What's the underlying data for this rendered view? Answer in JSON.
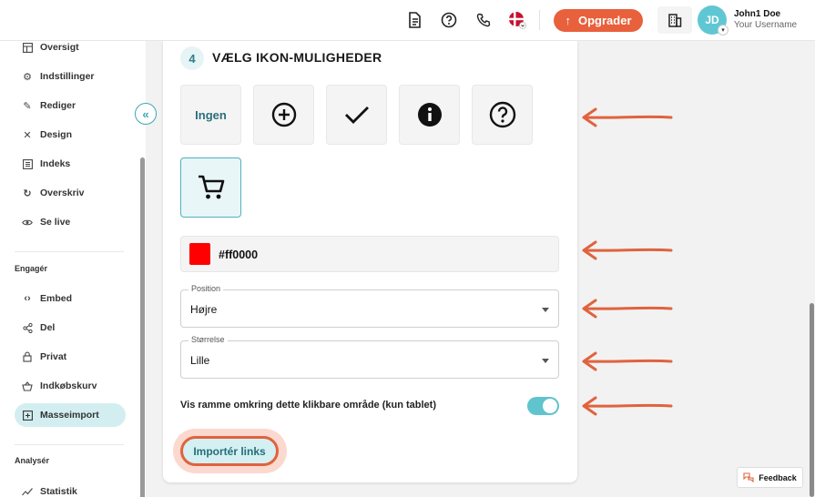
{
  "header": {
    "upgrade_label": "Opgrader",
    "user_name": "John1 Doe",
    "user_sub": "Your Username",
    "avatar_initials": "JD"
  },
  "sidebar": {
    "items": [
      {
        "label": "Oversigt",
        "icon": "layout-icon"
      },
      {
        "label": "Indstillinger",
        "icon": "gear-icon"
      },
      {
        "label": "Rediger",
        "icon": "pencil-icon"
      },
      {
        "label": "Design",
        "icon": "design-tools-icon"
      },
      {
        "label": "Indeks",
        "icon": "list-icon"
      },
      {
        "label": "Overskriv",
        "icon": "refresh-icon"
      },
      {
        "label": "Se live",
        "icon": "eye-icon"
      }
    ],
    "section_engage": "Engagér",
    "engage_items": [
      {
        "label": "Embed",
        "icon": "code-icon"
      },
      {
        "label": "Del",
        "icon": "share-icon"
      },
      {
        "label": "Privat",
        "icon": "lock-icon"
      },
      {
        "label": "Indkøbskurv",
        "icon": "basket-icon"
      },
      {
        "label": "Masseimport",
        "icon": "import-icon"
      }
    ],
    "section_analysis": "Analysér",
    "analysis_items": [
      {
        "label": "Statistik",
        "icon": "chart-line-icon"
      }
    ]
  },
  "main": {
    "step_number": "4",
    "step_title": "VÆLG IKON-MULIGHEDER",
    "icon_options": [
      {
        "label": "Ingen",
        "icon": "none"
      },
      {
        "icon": "plus-circle-icon"
      },
      {
        "icon": "checkmark-icon"
      },
      {
        "icon": "info-icon"
      },
      {
        "icon": "question-circle-icon"
      },
      {
        "icon": "cart-icon",
        "selected": true
      }
    ],
    "color_value": "#ff0000",
    "color_swatch": "#ff0000",
    "position": {
      "label": "Position",
      "value": "Højre"
    },
    "size": {
      "label": "Størrelse",
      "value": "Lille"
    },
    "toggle_label": "Vis ramme omkring dette klikbare område (kun tablet)",
    "toggle_on": true,
    "import_label": "Importér links"
  },
  "feedback_label": "Feedback",
  "colors": {
    "accent": "#e8603c",
    "teal": "#5fc4ce",
    "annotation_arrow": "#e0633e"
  }
}
